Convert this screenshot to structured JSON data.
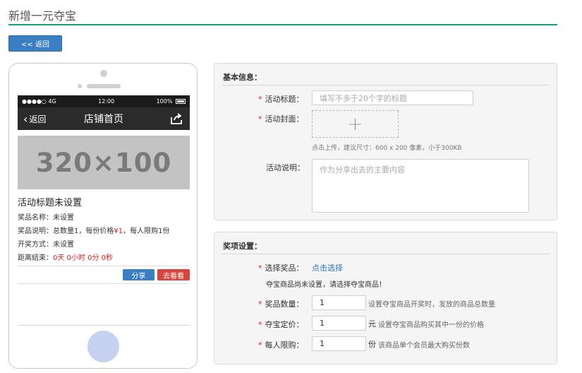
{
  "page": {
    "title": "新增一元夺宝",
    "back_label": "<< 返回"
  },
  "phone": {
    "status": {
      "signal": "●●●●○ 4G",
      "time": "12:00",
      "battery": "100%"
    },
    "nav": {
      "back": "返回",
      "title": "店铺首页"
    },
    "banner": "320×100",
    "activity_title": "活动标题未设置",
    "prize_name": "奖品名称：未设置",
    "prize_desc_prefix": "奖品说明：总数量1，每份价格",
    "prize_price": "¥1",
    "prize_desc_suffix": "，每人限购1份",
    "draw_method": "开奖方式：未设置",
    "countdown_label": "距离结束：",
    "countdown_value": "0天 0小时 0分 0秒",
    "share_btn": "分享",
    "look_btn": "去看看"
  },
  "basic": {
    "header": "基本信息：",
    "title_label": "活动标题：",
    "title_placeholder": "填写不多于20个字的标题",
    "cover_label": "活动封面：",
    "cover_plus": "+",
    "cover_hint": "点击上传，建议尺寸：600 x 200 像素，小于300KB",
    "desc_label": "活动说明：",
    "desc_placeholder": "作为分享出去的主要内容"
  },
  "prize": {
    "header": "奖项设置：",
    "choose_label": "选择奖品：",
    "choose_link": "点击选择",
    "choose_note": "夺宝商品尚未设置，请选择夺宝商品！",
    "qty_label": "奖品数量：",
    "qty_value": "1",
    "qty_hint": "设置夺宝商品开奖时，发放的商品总数量",
    "price_label": "夺宝定价：",
    "price_value": "1",
    "price_unit": "元",
    "price_hint": "设置夺宝商品购买其中一份的价格",
    "limit_label": "每人限购：",
    "limit_value": "1",
    "limit_unit": "份",
    "limit_hint": "该商品单个会员最大购买份数"
  },
  "colors": {
    "accent_green": "#1e9e73",
    "primary_blue": "#3a7fc4",
    "danger_red": "#d9443c",
    "required_red": "#e02020",
    "link_blue": "#2f76c6"
  }
}
